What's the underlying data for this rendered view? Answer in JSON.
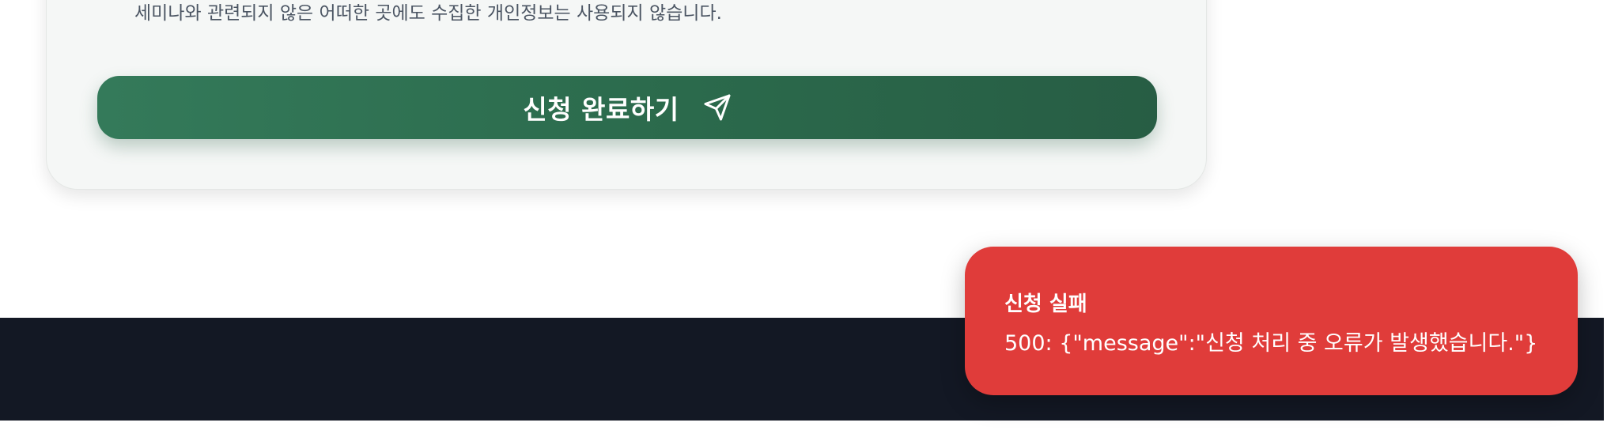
{
  "form": {
    "privacy_note": "세미나와 관련되지 않은 어떠한 곳에도 수집한 개인정보는 사용되지 않습니다.",
    "submit_label": "신청 완료하기",
    "submit_icon": "send-icon"
  },
  "toast": {
    "title": "신청 실패",
    "message": "500: {\"message\":\"신청 처리 중 오류가 발생했습니다.\"}",
    "color": "#e03c3a"
  },
  "colors": {
    "accent": "#2b6a4c",
    "footer": "#131824"
  }
}
